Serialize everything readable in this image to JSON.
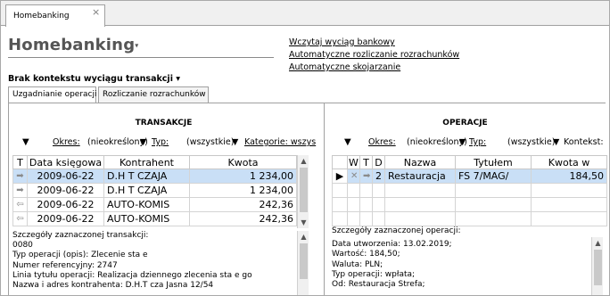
{
  "tab": {
    "label": "Homebanking",
    "close": "×"
  },
  "header": {
    "title": "Homebanking",
    "title_arrow": "▾",
    "links": [
      "Wczytaj wyciąg bankowy",
      "Automatyczne rozliczanie rozrachunków",
      "Automatyczne skojarzanie"
    ]
  },
  "context": {
    "label": "Brak kontekstu wyciągu transakcji",
    "arrow": "▾"
  },
  "inner_tabs": [
    "Uzgadnianie operacji",
    "Rozliczanie rozrachunków"
  ],
  "transactions": {
    "title": "TRANSAKCJE",
    "filter": {
      "okres_label": "Okres:",
      "okres_value": "(nieokreślony)",
      "typ_label": "Typ:",
      "typ_value": "(wszystkie)",
      "kategorie_label": "Kategorie: wszys"
    },
    "columns": [
      "T",
      "Data księgowa",
      "Kontrahent",
      "Kwota"
    ],
    "rows": [
      {
        "t": "➡",
        "date": "2009-06-22",
        "contractor": "D.H T  CZAJA",
        "amount": "1 234,00"
      },
      {
        "t": "➡",
        "date": "2009-06-22",
        "contractor": "D.H T  CZAJA",
        "amount": "1 234,00"
      },
      {
        "t": "⇦",
        "date": "2009-06-22",
        "contractor": "AUTO-KOMIS",
        "amount": "242,36"
      },
      {
        "t": "⇦",
        "date": "2009-06-22",
        "contractor": "AUTO-KOMIS",
        "amount": "242,36"
      }
    ],
    "details_label": "Szczegóły zaznaczonej transakcji:",
    "details": [
      "0080",
      "Typ operacji (opis): Zlecenie sta  e",
      "Numer referencyjny: 2747",
      "Linia tytułu operacji: Realizacja dziennego zlecenia sta  e go",
      "Nazwa i adres kontrahenta: D.H.T  cza  Jasna 12/54"
    ]
  },
  "operations": {
    "title": "OPERACJE",
    "filter": {
      "okres_label": "Okres:",
      "okres_value": "(nieokreślony)",
      "typ_label": "Typ:",
      "typ_value": "(wszystkie)",
      "kontekst_label": "Kontekst:"
    },
    "columns": [
      "",
      "W",
      "T",
      "D",
      "Nazwa",
      "Tytułem",
      "Kwota w"
    ],
    "rows": [
      {
        "ptr": "▶",
        "w": "✕",
        "t": "➡",
        "d": "2",
        "name": "Restauracja",
        "title": "FS 7/MAG/",
        "amount": "184,50"
      }
    ],
    "details_label": "Szczegóły zaznaczonej operacji:",
    "details": [
      "Data utworzenia: 13.02.2019;",
      "Wartość: 184,50;",
      "Waluta: PLN;",
      "Typ operacji: wpłata;",
      "Od: Restauracja Strefa;"
    ]
  },
  "colors": {
    "selection": "#c9dff6",
    "border": "#a0a0a0"
  }
}
